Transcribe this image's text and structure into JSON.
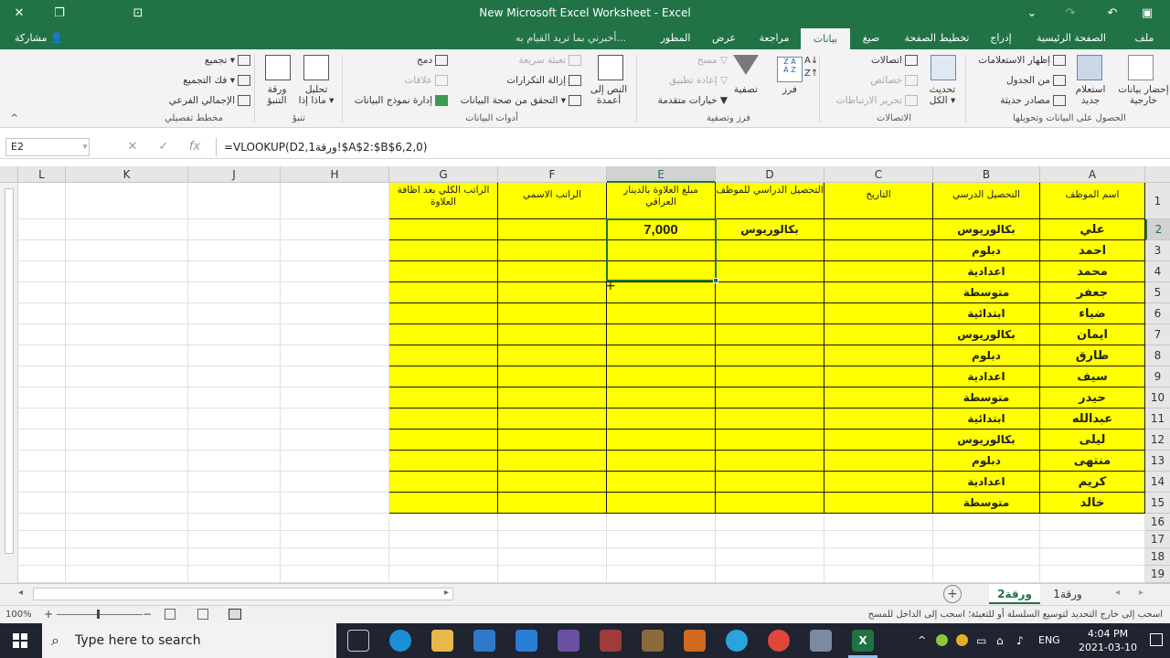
{
  "window": {
    "title": "New Microsoft Excel Worksheet - Excel"
  },
  "ribbon_tabs": [
    "ملف",
    "الصفحة الرئيسية",
    "إدراج",
    "تخطيط الصفحة",
    "صيغ",
    "بيانات",
    "مراجعة",
    "عرض",
    "المطور"
  ],
  "active_tab": "بيانات",
  "tell_me": "أخبرني بما تريد القيام به...",
  "share_label": "مشاركة",
  "ribbon": {
    "get_data": {
      "label1": "إحضار بيانات",
      "label2": "خارجية",
      "query": "استعلام",
      "query2": "جديد",
      "show_queries": "إظهار الاستعلامات",
      "from_table": "من الجدول",
      "recent": "مصادر حديثة",
      "group": "الحصول على البيانات وتحويلها"
    },
    "connections": {
      "refresh": "تحديث",
      "refresh2": "الكل",
      "conn": "اتصالات",
      "props": "خصائص",
      "edit_links": "تحرير الارتباطات",
      "group": "الاتصالات"
    },
    "sort_filter": {
      "sort": "فرز",
      "filter": "تصفية",
      "clear": "مسح",
      "reapply": "إعادة تطبيق",
      "advanced": "خيارات متقدمة",
      "group": "فرز وتصفية"
    },
    "data_tools": {
      "text_to_cols": "النص إلى",
      "text_to_cols2": "أعمدة",
      "flash_fill": "تعبئة سريعة",
      "remove_dup": "إزالة التكرارات",
      "validation": "التحقق من صحة البيانات",
      "consolidate": "دمج",
      "relationships": "علاقات",
      "data_model": "إدارة نموذج البيانات",
      "group": "أدوات البيانات"
    },
    "forecast": {
      "whatif": "تحليل",
      "whatif2": "ماذا إذا",
      "sheet": "ورقة",
      "sheet2": "التنبؤ",
      "group": "تنبؤ"
    },
    "outline": {
      "group_btn": "تجميع",
      "ungroup": "فك التجميع",
      "subtotal": "الإجمالي الفرعي",
      "group": "مخطط تفصيلي"
    }
  },
  "name_box": "E2",
  "formula": "=VLOOKUP(D2,ورقة1!$A$2:$B$6,2,0)",
  "columns": [
    "A",
    "B",
    "C",
    "D",
    "E",
    "F",
    "G",
    "H",
    "J",
    "K",
    "L"
  ],
  "headers": {
    "A": "اسم الموظف",
    "B": "التحصيل الدرسي",
    "C": "التاريخ",
    "D": "التحصيل الدراسي للموظف",
    "E": "مبلغ العلاوة بالدينار العراقي",
    "F": "الراتب الاسمي",
    "G": "الراتب الكلي بعد اظافة العلاوة"
  },
  "rows": [
    {
      "name": "علي",
      "edu": "بكالوريوس"
    },
    {
      "name": "احمد",
      "edu": "دبلوم"
    },
    {
      "name": "محمد",
      "edu": "اعدادية"
    },
    {
      "name": "جعفر",
      "edu": "متوسطة"
    },
    {
      "name": "ضياء",
      "edu": "ابتدائية"
    },
    {
      "name": "ايمان",
      "edu": "بكالوريوس"
    },
    {
      "name": "طارق",
      "edu": "دبلوم"
    },
    {
      "name": "سيف",
      "edu": "اعدادية"
    },
    {
      "name": "حيدر",
      "edu": "متوسطة"
    },
    {
      "name": "عبدالله",
      "edu": "ابتدائية"
    },
    {
      "name": "ليلى",
      "edu": "بكالوريوس"
    },
    {
      "name": "منتهى",
      "edu": "دبلوم"
    },
    {
      "name": "كريم",
      "edu": "اعدادية"
    },
    {
      "name": "خالد",
      "edu": "متوسطة"
    }
  ],
  "d2": "بكالوريوس",
  "e2": "7,000",
  "row_numbers": [
    "1",
    "2",
    "3",
    "4",
    "5",
    "6",
    "7",
    "8",
    "9",
    "10",
    "11",
    "12",
    "13",
    "14",
    "15",
    "16",
    "17",
    "18",
    "19"
  ],
  "sheet_tabs": [
    "ورقة1",
    "ورقة2"
  ],
  "active_sheet": "ورقة2",
  "status_text": "اسحب إلى خارج التحديد لتوسيع السلسلة أو للتعبئة؛ اسحب إلى الداخل للمسح",
  "zoom": "100%",
  "taskbar": {
    "search_placeholder": "Type here to search",
    "lang": "ENG",
    "time": "4:04 PM",
    "date": "2021-03-10"
  },
  "colors": {
    "excel_green": "#217346",
    "highlight": "#ffff00"
  }
}
